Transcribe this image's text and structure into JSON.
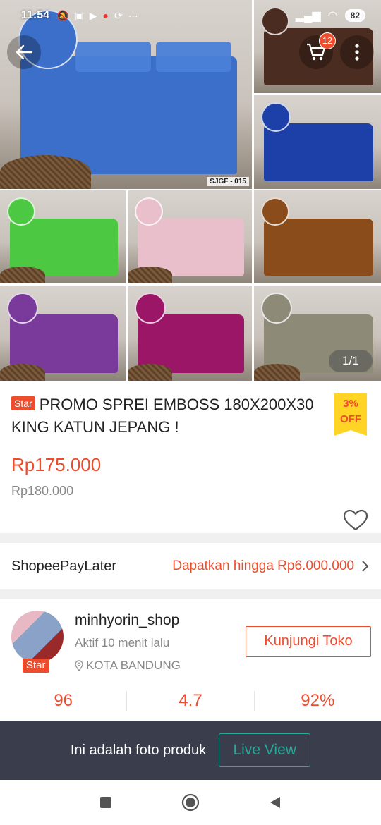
{
  "status_bar": {
    "time": "11:54",
    "icons": [
      "mute-icon",
      "message-icon",
      "play-store-icon",
      "record-icon",
      "sync-icon",
      "more-dots-icon"
    ],
    "right_icons": [
      "signal-icon",
      "signal-icon",
      "wifi-icon"
    ],
    "battery": "82"
  },
  "gallery": {
    "counter": "1/1",
    "main_code": "SJGF - 015",
    "colors": [
      "#3b6fc9",
      "#4a2c20",
      "#1c3fa8",
      "#4dc842",
      "#e9bfcc",
      "#8a4c1a",
      "#7a3a9c",
      "#9c1668",
      "#8d8a78"
    ]
  },
  "header": {
    "cart_count": "12"
  },
  "product": {
    "badge": "Star",
    "title": "PROMO SPREI EMBOSS 180X200X30 KING KATUN JEPANG !",
    "discount_pct": "3%",
    "discount_label": "OFF",
    "price": "Rp175.000",
    "original_price": "Rp180.000"
  },
  "paylater": {
    "label": "ShopeePayLater",
    "offer": "Dapatkan hingga Rp6.000.000"
  },
  "shop": {
    "name": "minhyorin_shop",
    "badge": "Star",
    "active": "Aktif 10 menit lalu",
    "location": "KOTA BANDUNG",
    "visit_label": "Kunjungi Toko",
    "stats": [
      "96",
      "4.7",
      "92%"
    ]
  },
  "live_bar": {
    "text": "Ini adalah foto produk",
    "button": "Live View"
  },
  "accent_color": "#ee4d2d",
  "teal_color": "#26aa99"
}
